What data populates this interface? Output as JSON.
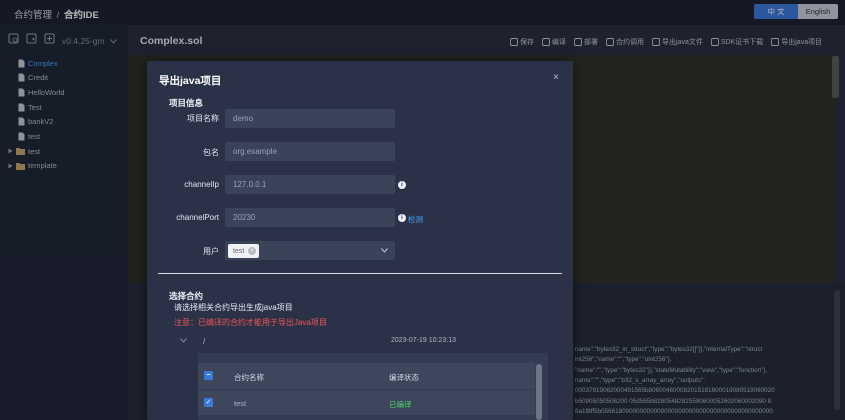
{
  "breadcrumb": {
    "parent": "合约管理",
    "separator": "/",
    "current": "合约IDE"
  },
  "language": {
    "zh": "中 文",
    "en": "English",
    "active": "zh",
    "active_color": "#3a79d9"
  },
  "sidebar": {
    "version": "v0.4.25-gm",
    "files": [
      {
        "name": "Complex",
        "type": "file",
        "active": true
      },
      {
        "name": "Credit",
        "type": "file"
      },
      {
        "name": "HelloWorld",
        "type": "file"
      },
      {
        "name": "Test",
        "type": "file"
      },
      {
        "name": "bankV2",
        "type": "file"
      },
      {
        "name": "test",
        "type": "file"
      },
      {
        "name": "test",
        "type": "folder"
      },
      {
        "name": "template",
        "type": "folder"
      }
    ]
  },
  "editor": {
    "file_title": "Complex.sol",
    "toolbar": [
      "保存",
      "编译",
      "部署",
      "合约调用",
      "导出java文件",
      "SDK证书下载",
      "导出java项目"
    ]
  },
  "output_lines": [
    "name\":\"bytes32_in_struct\",\"type\":\"bytes32[]\"}],\"internalType\":\"struct",
    "int256\",\"name\":\"\",\"type\":\"uint256\"},",
    "\"name\":\"\",\"type\":\"bytes32\"}],\"stateMutability\":\"view\",\"type\":\"function\"},",
    "name\":\"\",\"type\":\"b32_s_array_array\",\"outputs\":",
    "00037919062000491565b806004600082015181600019080519060020",
    "b50905050506200 05d565b82805482825590600052602060002090 8",
    "8a1f8ff5b0566180000000000000000000000000000000000000000000"
  ],
  "modal": {
    "title": "导出java项目",
    "close": "×",
    "project_info_title": "项目信息",
    "fields": {
      "project_name": {
        "label": "项目名称",
        "value": "demo"
      },
      "package": {
        "label": "包名",
        "value": "org.example"
      },
      "channel_ip": {
        "label": "channelIp",
        "value": "127.0.0.1"
      },
      "channel_port": {
        "label": "channelPort",
        "value": "20230",
        "detect": "检测"
      },
      "user": {
        "label": "用户",
        "tag": "test"
      }
    },
    "select_contract_title": "选择合约",
    "hint": "请选择相关合约导出生成java项目",
    "warning": "注意：已编译的合约才能用于导出Java项目",
    "group": {
      "path": "/",
      "date": "2023-07-19 10:23:13"
    },
    "table": {
      "headers": [
        "合约名称",
        "编译状态"
      ],
      "rows": [
        {
          "name": "test",
          "status": "已编译",
          "checked": true
        }
      ]
    }
  }
}
